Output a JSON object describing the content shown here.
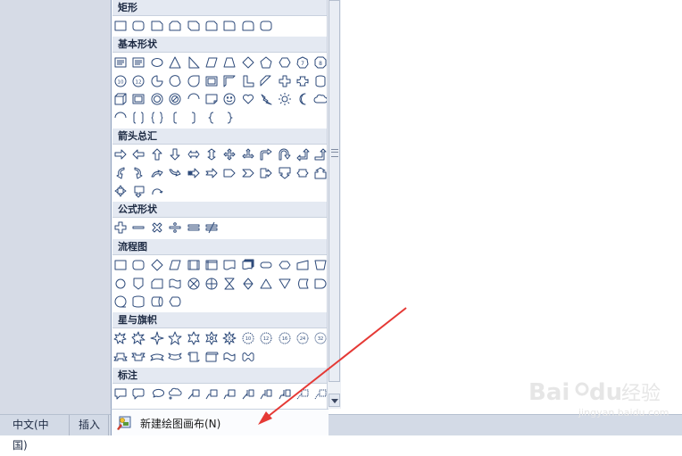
{
  "sections": [
    {
      "label": "矩形",
      "shapes": [
        "rect",
        "rrect",
        "snip1",
        "snip2",
        "snip3",
        "snipround",
        "round1",
        "round2",
        "rrect"
      ]
    },
    {
      "label": "基本形状",
      "shapes": [
        "textbox",
        "textbox",
        "oval",
        "tri",
        "rtri",
        "para",
        "trap",
        "diamond",
        "pent",
        "hex",
        "hept",
        "oct",
        "dec",
        "dodec",
        "pie",
        "chord",
        "teardrop",
        "frame",
        "halfframe",
        "lshape",
        "diagstripe",
        "plus",
        "plaque",
        "can",
        "cube",
        "bevel",
        "donut",
        "nosmoking",
        "arc",
        "foldcorner",
        "smiley",
        "heart",
        "bolt",
        "sun",
        "moon",
        "cloud",
        "arc",
        "bracketpair",
        "bracepair",
        "leftbracket",
        "rightbracket",
        "leftbrace",
        "rightbrace"
      ]
    },
    {
      "label": "箭头总汇",
      "shapes": [
        "arrowR",
        "arrowL",
        "arrowU",
        "arrowD",
        "arrowLR",
        "arrowUD",
        "quad",
        "leftright_up",
        "bent",
        "uturn",
        "leftup",
        "bentup",
        "curveR",
        "curveL",
        "curveU",
        "curveD",
        "striped",
        "notched",
        "pentagon",
        "chevron",
        "calloutR",
        "calloutD",
        "calloutLR",
        "calloutU",
        "calloutQuad",
        "quadcallout",
        "circulararrow"
      ]
    },
    {
      "label": "公式形状",
      "shapes": [
        "plus",
        "minus",
        "mult",
        "div",
        "equal",
        "notequal"
      ]
    },
    {
      "label": "流程图",
      "shapes": [
        "rect",
        "rrect",
        "diamond",
        "para",
        "predef",
        "internal",
        "doc",
        "multidoc",
        "terminator",
        "prep",
        "manual",
        "manop",
        "circle",
        "offpage",
        "card",
        "tape",
        "sumjunc",
        "or",
        "collate",
        "sort",
        "extract",
        "merge",
        "stored",
        "delay",
        "seqaccess",
        "magdisk",
        "directaccess",
        "display"
      ]
    },
    {
      "label": "星与旗帜",
      "shapes": [
        "explosion1",
        "explosion2",
        "star4",
        "star5",
        "star6",
        "star7",
        "star8",
        "star10",
        "star12",
        "star16",
        "star24",
        "star32",
        "ribbonup",
        "ribbondown",
        "curvedup",
        "curveddown",
        "scrollV",
        "scrollH",
        "wave",
        "dblwave"
      ]
    },
    {
      "label": "标注",
      "shapes": [
        "rectcallout",
        "rrectcallout",
        "ovalcallout",
        "cloudcallout",
        "line1",
        "line2",
        "line3",
        "line4",
        "line5",
        "line6",
        "line7",
        "line8"
      ]
    }
  ],
  "footer": {
    "label": "新建绘图画布(N)",
    "icon": "canvas-icon"
  },
  "status_bar": {
    "language": "中文(中国)",
    "mode": "插入"
  },
  "watermark": {
    "text": "Baidu经验",
    "sub": "jingyan.baidu.com"
  },
  "colors": {
    "shape_stroke": "#2d4a7a",
    "shape_fill": "#ffffff",
    "header_bg": "#e4e9f2",
    "arrow": "#e53935"
  }
}
